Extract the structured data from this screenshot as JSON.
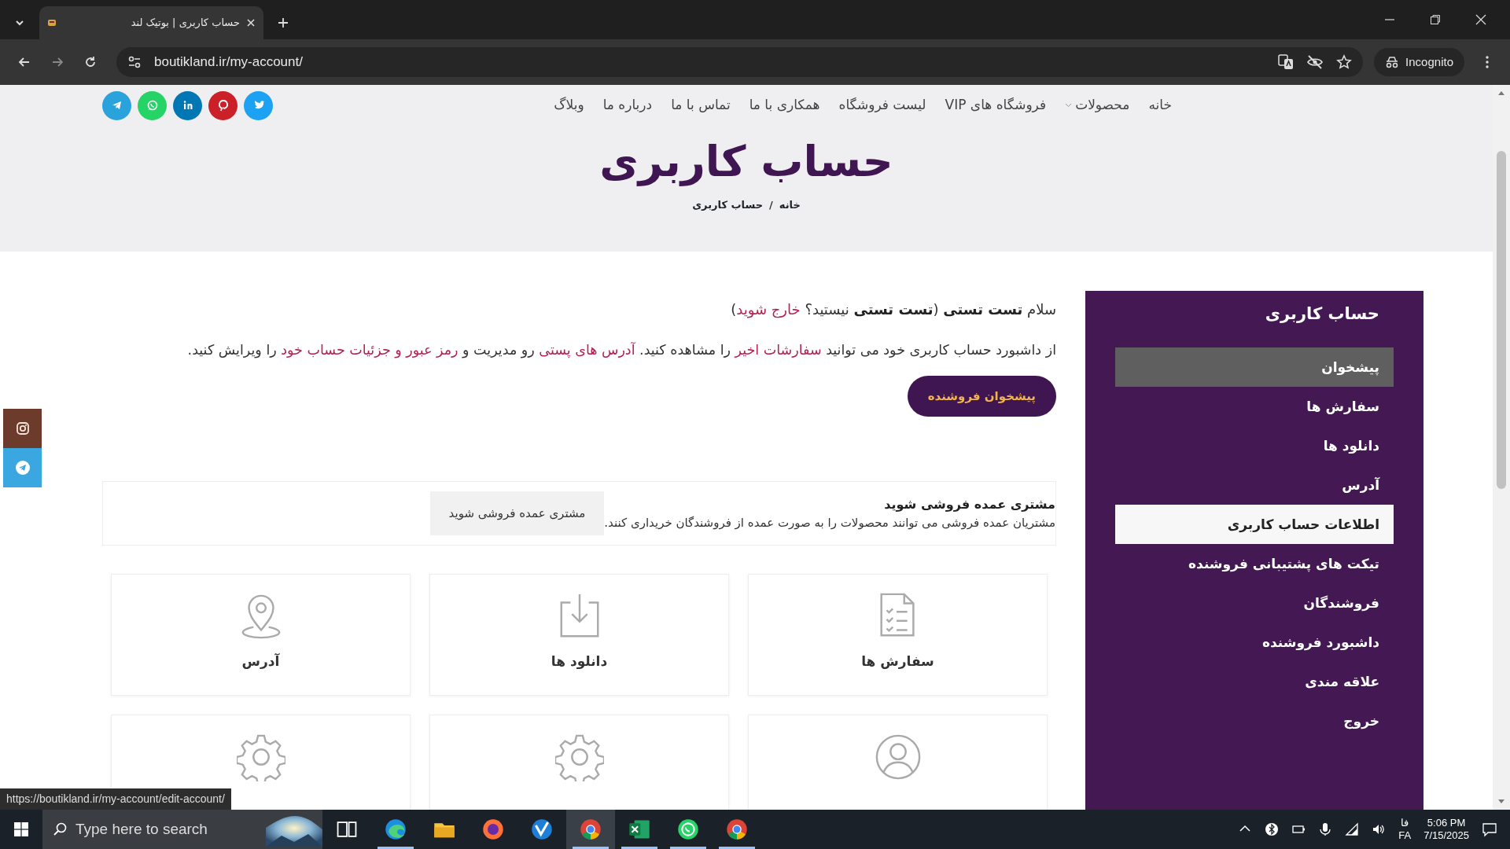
{
  "browser": {
    "tab_title": "حساب کاربری | بوتیک لند",
    "url": "boutikland.ir/my-account/",
    "profile": "Incognito",
    "status_url": "https://boutikland.ir/my-account/edit-account/"
  },
  "nav": [
    {
      "label": "خانه",
      "dropdown": false
    },
    {
      "label": "محصولات",
      "dropdown": true
    },
    {
      "label": "فروشگاه های VIP",
      "dropdown": false
    },
    {
      "label": "لیست فروشگاه",
      "dropdown": false
    },
    {
      "label": "همکاری با ما",
      "dropdown": false
    },
    {
      "label": "تماس با ما",
      "dropdown": false
    },
    {
      "label": "درباره ما",
      "dropdown": false
    },
    {
      "label": "وبلاگ",
      "dropdown": false
    }
  ],
  "header": {
    "title": "حساب کاربری",
    "breadcrumb": [
      "خانه",
      "حساب کاربری"
    ],
    "breadcrumb_separator": "/"
  },
  "welcome": [
    {
      "kind": "text",
      "text": "سلام "
    },
    {
      "kind": "bold",
      "text": "تست تستی"
    },
    {
      "kind": "text",
      "text": " ("
    },
    {
      "kind": "bold",
      "text": "تست تستی"
    },
    {
      "kind": "text",
      "text": " نیستید؟ "
    },
    {
      "kind": "link",
      "text": "خارج شوید"
    },
    {
      "kind": "text",
      "text": ")"
    }
  ],
  "intro": [
    {
      "kind": "text",
      "text": "از داشبورد حساب کاربری خود می توانید "
    },
    {
      "kind": "link",
      "text": "سفارشات اخیر"
    },
    {
      "kind": "text",
      "text": " را مشاهده کنید. "
    },
    {
      "kind": "link",
      "text": "آدرس های پستی"
    },
    {
      "kind": "text",
      "text": " رو مدیریت و "
    },
    {
      "kind": "link",
      "text": "رمز عبور و جزئیات حساب خود"
    },
    {
      "kind": "text",
      "text": " را ویرایش کنید."
    }
  ],
  "seller_button": "پیشخوان فروشنده",
  "wholesale": {
    "title": "مشتری عمده فروشی شوید",
    "text": "مشتریان عمده فروشی می توانند محصولات را به صورت عمده از فروشندگان خریداری کنند.",
    "button": "مشتری عمده فروشی شوید"
  },
  "tiles": [
    {
      "label": "سفارش ها"
    },
    {
      "label": "دانلود ها"
    },
    {
      "label": "آدرس"
    }
  ],
  "sidebar": {
    "title": "حساب کاربری",
    "items": [
      {
        "label": "پیشخوان",
        "selected": true,
        "hovered": false
      },
      {
        "label": "سفارش ها",
        "selected": false,
        "hovered": false
      },
      {
        "label": "دانلود ها",
        "selected": false,
        "hovered": false
      },
      {
        "label": "آدرس",
        "selected": false,
        "hovered": false
      },
      {
        "label": "اطلاعات حساب کاربری",
        "selected": false,
        "hovered": true
      },
      {
        "label": "تیکت های پشتیبانی فروشنده",
        "selected": false,
        "hovered": false
      },
      {
        "label": "فروشندگان",
        "selected": false,
        "hovered": false
      },
      {
        "label": "داشبورد فروشنده",
        "selected": false,
        "hovered": false
      },
      {
        "label": "علاقه مندی",
        "selected": false,
        "hovered": false
      },
      {
        "label": "خروج",
        "selected": false,
        "hovered": false
      }
    ]
  },
  "taskbar": {
    "search_placeholder": "Type here to search",
    "input_indicator": "فا",
    "language": "FA",
    "time": "5:06 PM",
    "date": "7/15/2025"
  }
}
